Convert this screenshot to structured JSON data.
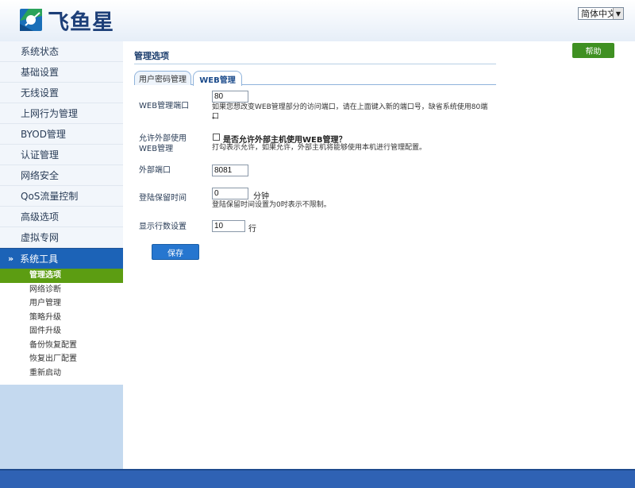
{
  "header": {
    "logo_text": "飞鱼星",
    "language": "简体中文"
  },
  "sidebar": {
    "items": [
      {
        "label": "系统状态"
      },
      {
        "label": "基础设置"
      },
      {
        "label": "无线设置"
      },
      {
        "label": "上网行为管理"
      },
      {
        "label": "BYOD管理"
      },
      {
        "label": "认证管理"
      },
      {
        "label": "网络安全"
      },
      {
        "label": "QoS流量控制"
      },
      {
        "label": "高级选项"
      },
      {
        "label": "虚拟专网"
      }
    ],
    "group": {
      "label": "系统工具",
      "sub_items": [
        {
          "label": "管理选项",
          "active": true
        },
        {
          "label": "网络诊断"
        },
        {
          "label": "用户管理"
        },
        {
          "label": "策略升级"
        },
        {
          "label": "固件升级"
        },
        {
          "label": "备份恢复配置"
        },
        {
          "label": "恢复出厂配置"
        },
        {
          "label": "重新启动"
        }
      ]
    }
  },
  "main": {
    "help_label": "帮助",
    "title": "管理选项",
    "tabs": [
      {
        "label": "用户密码管理"
      },
      {
        "label": "WEB管理",
        "active": true
      }
    ],
    "form": {
      "web_port_label": "WEB管理端口",
      "web_port_value": "80",
      "web_port_hint": "如果您想改变WEB管理部分的访问端口，请在上面键入新的端口号，缺省系统使用80端口",
      "web_port_hint_tail": "。",
      "allow_external_label_1": "允许外部使用",
      "allow_external_label_2": "WEB管理",
      "allow_external_checkbox_label": "是否允许外部主机使用WEB管理？",
      "allow_external_hint": "打勾表示允许，如果允许，外部主机将能够使用本机进行管理配置。",
      "allow_external_checked": false,
      "external_port_label": "外部端口",
      "external_port_value": "8081",
      "session_time_label": "登陆保留时间",
      "session_time_value": "0",
      "session_time_unit": "分钟",
      "session_time_hint": "登陆保留时间设置为0时表示不限制。",
      "rows_label": "显示行数设置",
      "rows_value": "10",
      "rows_unit": "行",
      "save_label": "保存"
    }
  },
  "colors": {
    "accent_blue": "#1c63b7",
    "active_green": "#5c9d12",
    "help_green": "#3f9022",
    "footer_blue": "#2f62b4"
  }
}
